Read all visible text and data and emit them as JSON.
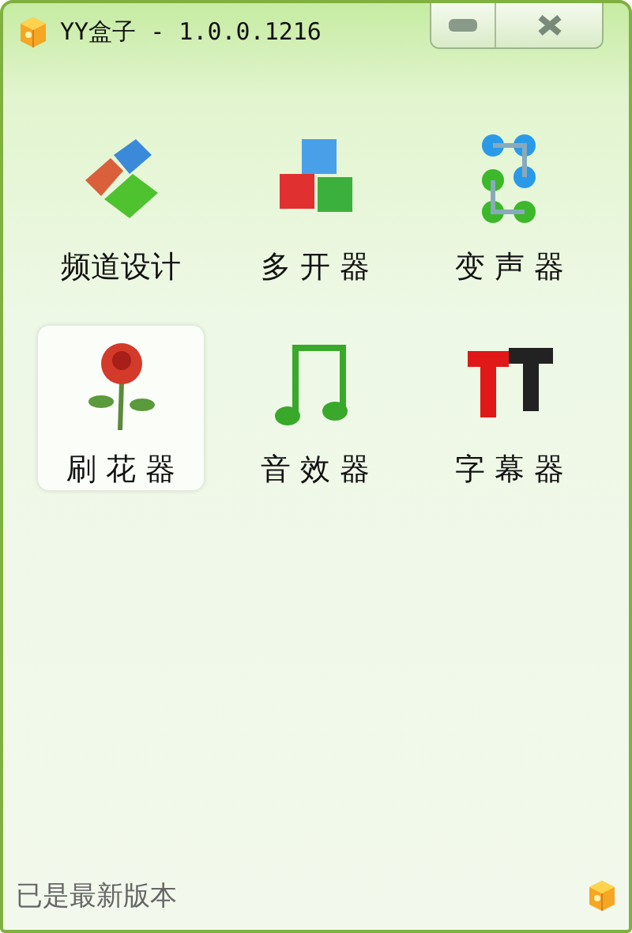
{
  "window": {
    "title": "YY盒子 - 1.0.0.1216"
  },
  "tools": [
    {
      "label": "频道设计",
      "kind": "blocks",
      "selected": false
    },
    {
      "label": "多 开 器",
      "kind": "cubes",
      "selected": false
    },
    {
      "label": "变 声 器",
      "kind": "dots",
      "selected": false
    },
    {
      "label": "刷 花 器",
      "kind": "flower",
      "selected": true
    },
    {
      "label": "音 效 器",
      "kind": "note",
      "selected": false
    },
    {
      "label": "字 幕 器",
      "kind": "letters",
      "selected": false
    }
  ],
  "status_bar": {
    "text": "已是最新版本"
  }
}
